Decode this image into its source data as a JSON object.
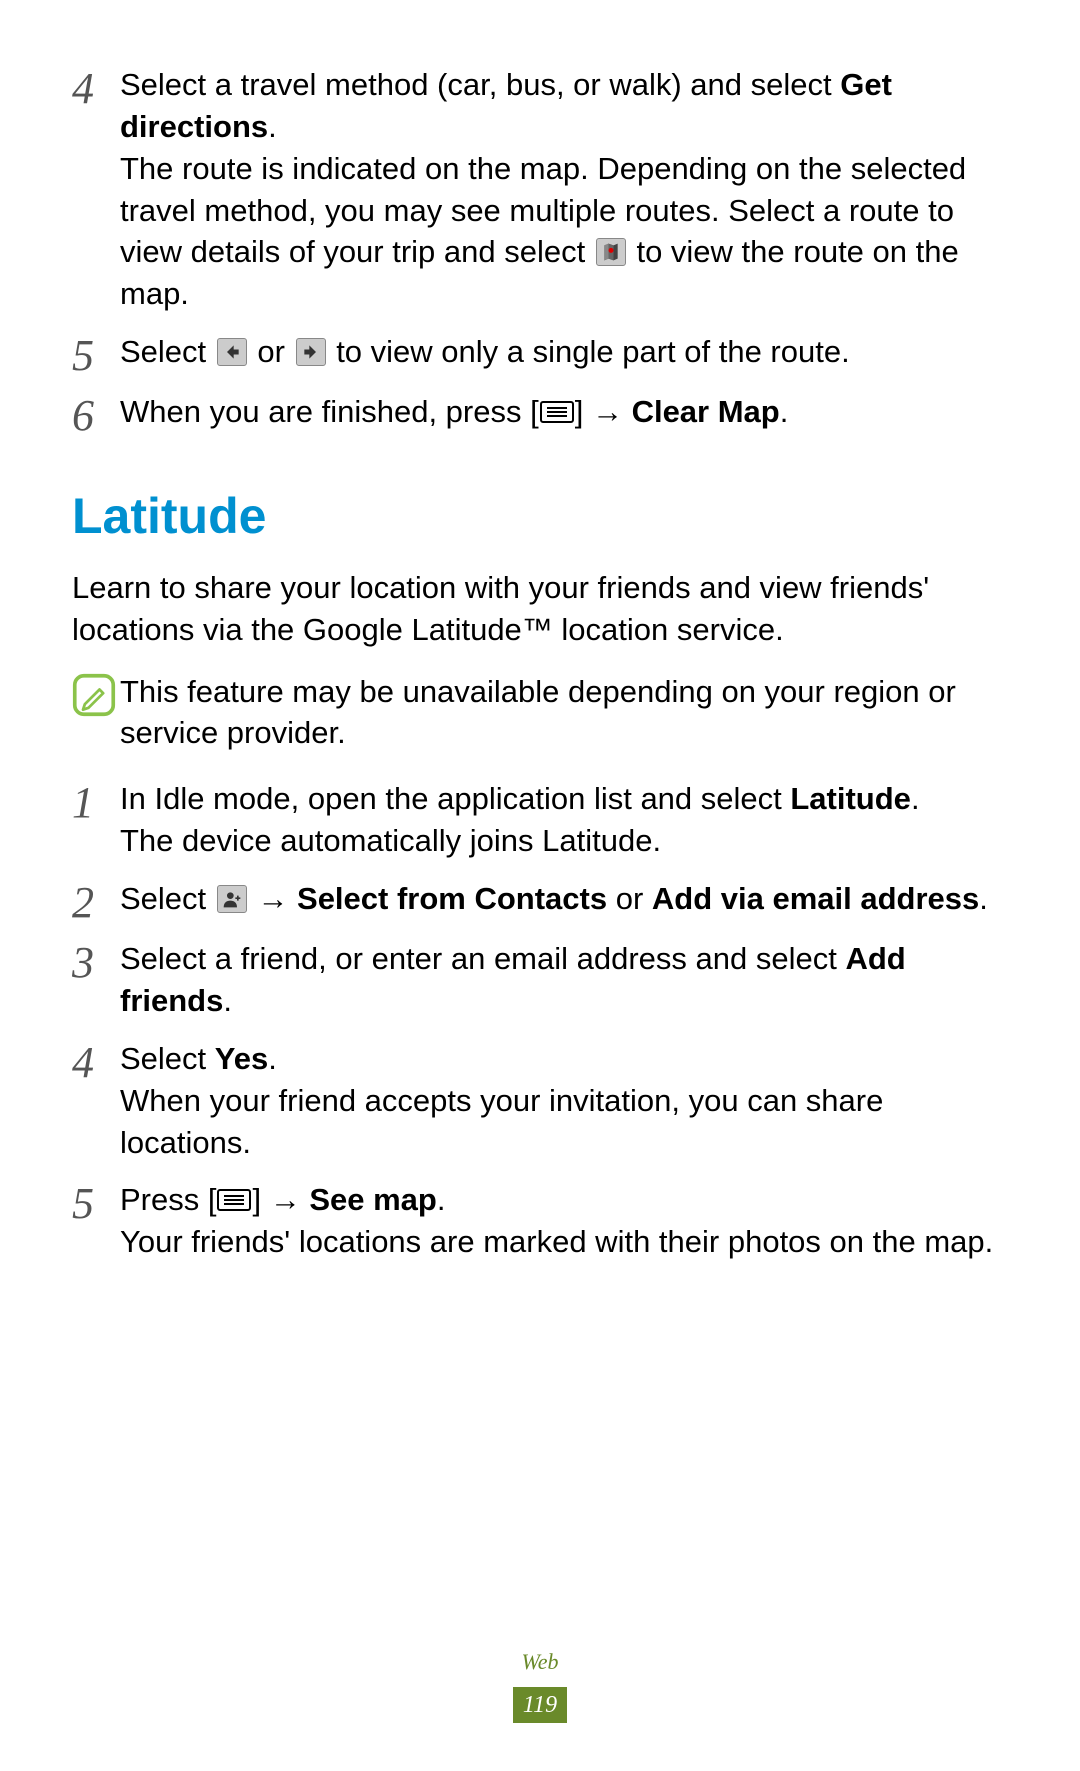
{
  "steps_top": [
    {
      "num": "4",
      "html": "Select a travel method (car, bus, or walk) and select <span class=\"bold\">Get directions</span>.<br>The route is indicated on the map. Depending on the selected travel method, you may see multiple routes. Select a route to view details of your trip and select {icon:map} to view the route on the map."
    },
    {
      "num": "5",
      "html": "Select {icon:left} or {icon:right} to view only a single part of the route."
    },
    {
      "num": "6",
      "html": "When you are finished, press [{icon:menu}] → <span class=\"bold\">Clear Map</span>."
    }
  ],
  "section": {
    "title": "Latitude",
    "lead": "Learn to share your location with your friends and view friends' locations via the Google Latitude™ location service.",
    "note": "This feature may be unavailable depending on your region or service provider."
  },
  "steps_bottom": [
    {
      "num": "1",
      "html": "In Idle mode, open the application list and select <span class=\"bold\">Latitude</span>.<br>The device automatically joins Latitude."
    },
    {
      "num": "2",
      "html": "Select {icon:addperson} → <span class=\"bold\">Select from Contacts</span> or <span class=\"bold\">Add via email address</span>."
    },
    {
      "num": "3",
      "html": "Select a friend, or enter an email address and select <span class=\"bold\">Add friends</span>."
    },
    {
      "num": "4",
      "html": "Select <span class=\"bold\">Yes</span>.<br>When your friend accepts your invitation, you can share locations."
    },
    {
      "num": "5",
      "html": "Press [{icon:menu}] → <span class=\"bold\">See map</span>.<br>Your friends' locations are marked with their photos on the map."
    }
  ],
  "footer": {
    "section_label": "Web",
    "page": "119"
  }
}
